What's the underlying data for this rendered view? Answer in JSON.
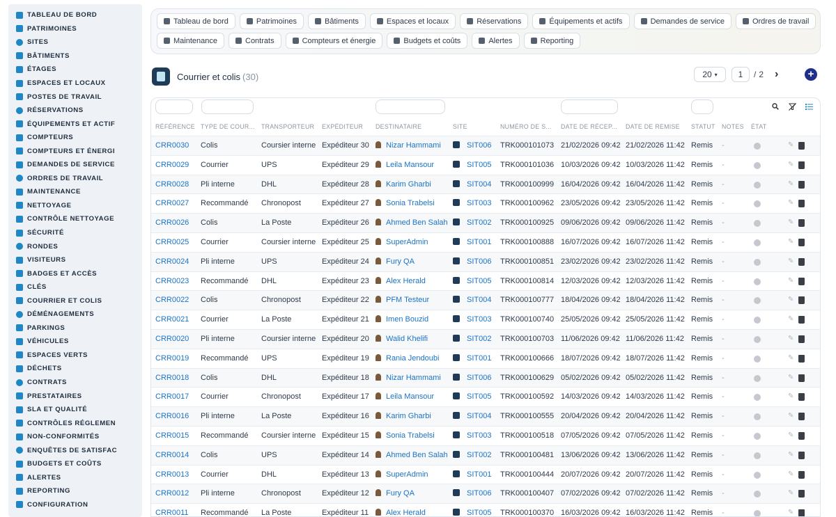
{
  "sidebar": {
    "items": [
      {
        "label": "Tableau de bord",
        "icon": "dashboard-icon"
      },
      {
        "label": "Patrimoines",
        "icon": "buildings-icon"
      },
      {
        "label": "Sites",
        "icon": "map-pin-icon"
      },
      {
        "label": "Bâtiments",
        "icon": "building-icon"
      },
      {
        "label": "Étages",
        "icon": "layers-icon"
      },
      {
        "label": "Espaces et locaux",
        "icon": "door-icon"
      },
      {
        "label": "Postes de travail",
        "icon": "monitor-icon"
      },
      {
        "label": "Réservations",
        "icon": "calendar-icon"
      },
      {
        "label": "Équipements et actif",
        "icon": "gears-icon"
      },
      {
        "label": "Compteurs",
        "icon": "gauge-icon"
      },
      {
        "label": "Compteurs et énergi",
        "icon": "bolt-icon"
      },
      {
        "label": "Demandes de service",
        "icon": "clipboard-icon"
      },
      {
        "label": "Ordres de travail",
        "icon": "tools-icon"
      },
      {
        "label": "Maintenance",
        "icon": "wrench-icon"
      },
      {
        "label": "Nettoyage",
        "icon": "broom-icon"
      },
      {
        "label": "Contrôle nettoyage",
        "icon": "check-icon"
      },
      {
        "label": "Sécurité",
        "icon": "shield-icon"
      },
      {
        "label": "Rondes",
        "icon": "route-icon"
      },
      {
        "label": "Visiteurs",
        "icon": "id-card-icon"
      },
      {
        "label": "Badges et accès",
        "icon": "badge-icon"
      },
      {
        "label": "Clés",
        "icon": "key-icon"
      },
      {
        "label": "Courrier et colis",
        "icon": "envelope-icon"
      },
      {
        "label": "Déménagements",
        "icon": "dolly-icon"
      },
      {
        "label": "Parkings",
        "icon": "parking-icon"
      },
      {
        "label": "Véhicules",
        "icon": "car-icon"
      },
      {
        "label": "Espaces verts",
        "icon": "leaf-icon"
      },
      {
        "label": "Déchets",
        "icon": "trash-icon"
      },
      {
        "label": "Contrats",
        "icon": "file-icon"
      },
      {
        "label": "Prestataires",
        "icon": "truck-icon"
      },
      {
        "label": "SLA et qualité",
        "icon": "award-icon"
      },
      {
        "label": "Contrôles réglemen",
        "icon": "checklist-icon"
      },
      {
        "label": "Non-conformités",
        "icon": "alert-circle-icon"
      },
      {
        "label": "Enquêtes de satisfac",
        "icon": "star-icon"
      },
      {
        "label": "Budgets et coûts",
        "icon": "coins-icon"
      },
      {
        "label": "Alertes",
        "icon": "bell-icon"
      },
      {
        "label": "Reporting",
        "icon": "chart-icon"
      },
      {
        "label": "Configuration",
        "icon": "cog-icon"
      }
    ]
  },
  "nav": {
    "row1": [
      {
        "label": "Tableau de bord",
        "icon": "dashboard-icon"
      },
      {
        "label": "Patrimoines",
        "icon": "buildings-icon"
      },
      {
        "label": "Bâtiments",
        "icon": "building-icon"
      },
      {
        "label": "Espaces et locaux",
        "icon": "door-icon"
      },
      {
        "label": "Réservations",
        "icon": "calendar-icon"
      },
      {
        "label": "Équipements et actifs",
        "icon": "gears-icon"
      },
      {
        "label": "Demandes de service",
        "icon": "clipboard-icon"
      },
      {
        "label": "Ordres de travail",
        "icon": "tools-icon"
      }
    ],
    "row2": [
      {
        "label": "Maintenance",
        "icon": "wrench-icon"
      },
      {
        "label": "Contrats",
        "icon": "file-icon"
      },
      {
        "label": "Compteurs et énergie",
        "icon": "bolt-icon"
      },
      {
        "label": "Budgets et coûts",
        "icon": "coins-icon"
      },
      {
        "label": "Alertes",
        "icon": "bell-icon"
      },
      {
        "label": "Reporting",
        "icon": "chart-icon"
      }
    ]
  },
  "page": {
    "title": "Courrier et colis",
    "count": "(30)"
  },
  "pager": {
    "per_page": "20",
    "page": "1",
    "sep": "/",
    "total": "2",
    "next": "›",
    "add": "+"
  },
  "table": {
    "columns": [
      "Référence",
      "Type de cour...",
      "Transporteur",
      "Expéditeur",
      "Destinataire",
      "Site",
      "Numéro de s...",
      "Date de récep...",
      "Date de remise",
      "Statut",
      "Notes",
      "État"
    ],
    "rows": [
      [
        "CRR0030",
        "Colis",
        "Coursier interne",
        "Expéditeur 30",
        "Nizar Hammami",
        "SIT006",
        "TRK000101073",
        "21/02/2026 09:42",
        "21/02/2026 11:42",
        "Remis",
        "-"
      ],
      [
        "CRR0029",
        "Courrier",
        "UPS",
        "Expéditeur 29",
        "Leila Mansour",
        "SIT005",
        "TRK000101036",
        "10/03/2026 09:42",
        "10/03/2026 11:42",
        "Remis",
        "-"
      ],
      [
        "CRR0028",
        "Pli interne",
        "DHL",
        "Expéditeur 28",
        "Karim Gharbi",
        "SIT004",
        "TRK000100999",
        "16/04/2026 09:42",
        "16/04/2026 11:42",
        "Remis",
        "-"
      ],
      [
        "CRR0027",
        "Recommandé",
        "Chronopost",
        "Expéditeur 27",
        "Sonia Trabelsi",
        "SIT003",
        "TRK000100962",
        "23/05/2026 09:42",
        "23/05/2026 11:42",
        "Remis",
        "-"
      ],
      [
        "CRR0026",
        "Colis",
        "La Poste",
        "Expéditeur 26",
        "Ahmed Ben Salah",
        "SIT002",
        "TRK000100925",
        "09/06/2026 09:42",
        "09/06/2026 11:42",
        "Remis",
        "-"
      ],
      [
        "CRR0025",
        "Courrier",
        "Coursier interne",
        "Expéditeur 25",
        "SuperAdmin",
        "SIT001",
        "TRK000100888",
        "16/07/2026 09:42",
        "16/07/2026 11:42",
        "Remis",
        "-"
      ],
      [
        "CRR0024",
        "Pli interne",
        "UPS",
        "Expéditeur 24",
        "Fury QA",
        "SIT006",
        "TRK000100851",
        "23/02/2026 09:42",
        "23/02/2026 11:42",
        "Remis",
        "-"
      ],
      [
        "CRR0023",
        "Recommandé",
        "DHL",
        "Expéditeur 23",
        "Alex Herald",
        "SIT005",
        "TRK000100814",
        "12/03/2026 09:42",
        "12/03/2026 11:42",
        "Remis",
        "-"
      ],
      [
        "CRR0022",
        "Colis",
        "Chronopost",
        "Expéditeur 22",
        "PFM Testeur",
        "SIT004",
        "TRK000100777",
        "18/04/2026 09:42",
        "18/04/2026 11:42",
        "Remis",
        "-"
      ],
      [
        "CRR0021",
        "Courrier",
        "La Poste",
        "Expéditeur 21",
        "Imen Bouzid",
        "SIT003",
        "TRK000100740",
        "25/05/2026 09:42",
        "25/05/2026 11:42",
        "Remis",
        "-"
      ],
      [
        "CRR0020",
        "Pli interne",
        "Coursier interne",
        "Expéditeur 20",
        "Walid Khelifi",
        "SIT002",
        "TRK000100703",
        "11/06/2026 09:42",
        "11/06/2026 11:42",
        "Remis",
        "-"
      ],
      [
        "CRR0019",
        "Recommandé",
        "UPS",
        "Expéditeur 19",
        "Rania Jendoubi",
        "SIT001",
        "TRK000100666",
        "18/07/2026 09:42",
        "18/07/2026 11:42",
        "Remis",
        "-"
      ],
      [
        "CRR0018",
        "Colis",
        "DHL",
        "Expéditeur 18",
        "Nizar Hammami",
        "SIT006",
        "TRK000100629",
        "05/02/2026 09:42",
        "05/02/2026 11:42",
        "Remis",
        "-"
      ],
      [
        "CRR0017",
        "Courrier",
        "Chronopost",
        "Expéditeur 17",
        "Leila Mansour",
        "SIT005",
        "TRK000100592",
        "14/03/2026 09:42",
        "14/03/2026 11:42",
        "Remis",
        "-"
      ],
      [
        "CRR0016",
        "Pli interne",
        "La Poste",
        "Expéditeur 16",
        "Karim Gharbi",
        "SIT004",
        "TRK000100555",
        "20/04/2026 09:42",
        "20/04/2026 11:42",
        "Remis",
        "-"
      ],
      [
        "CRR0015",
        "Recommandé",
        "Coursier interne",
        "Expéditeur 15",
        "Sonia Trabelsi",
        "SIT003",
        "TRK000100518",
        "07/05/2026 09:42",
        "07/05/2026 11:42",
        "Remis",
        "-"
      ],
      [
        "CRR0014",
        "Colis",
        "UPS",
        "Expéditeur 14",
        "Ahmed Ben Salah",
        "SIT002",
        "TRK000100481",
        "13/06/2026 09:42",
        "13/06/2026 11:42",
        "Remis",
        "-"
      ],
      [
        "CRR0013",
        "Courrier",
        "DHL",
        "Expéditeur 13",
        "SuperAdmin",
        "SIT001",
        "TRK000100444",
        "20/07/2026 09:42",
        "20/07/2026 11:42",
        "Remis",
        "-"
      ],
      [
        "CRR0012",
        "Pli interne",
        "Chronopost",
        "Expéditeur 12",
        "Fury QA",
        "SIT006",
        "TRK000100407",
        "07/02/2026 09:42",
        "07/02/2026 11:42",
        "Remis",
        "-"
      ],
      [
        "CRR0011",
        "Recommandé",
        "La Poste",
        "Expéditeur 11",
        "Alex Herald",
        "SIT005",
        "TRK000100370",
        "16/03/2026 09:42",
        "16/03/2026 11:42",
        "Remis",
        "-"
      ]
    ]
  },
  "colors": {
    "accent": "#1a73c7",
    "sidebar_bg": "#eef1f6",
    "primary_dark": "#1f2f8a",
    "state_inactive": "#c5c9cf"
  }
}
